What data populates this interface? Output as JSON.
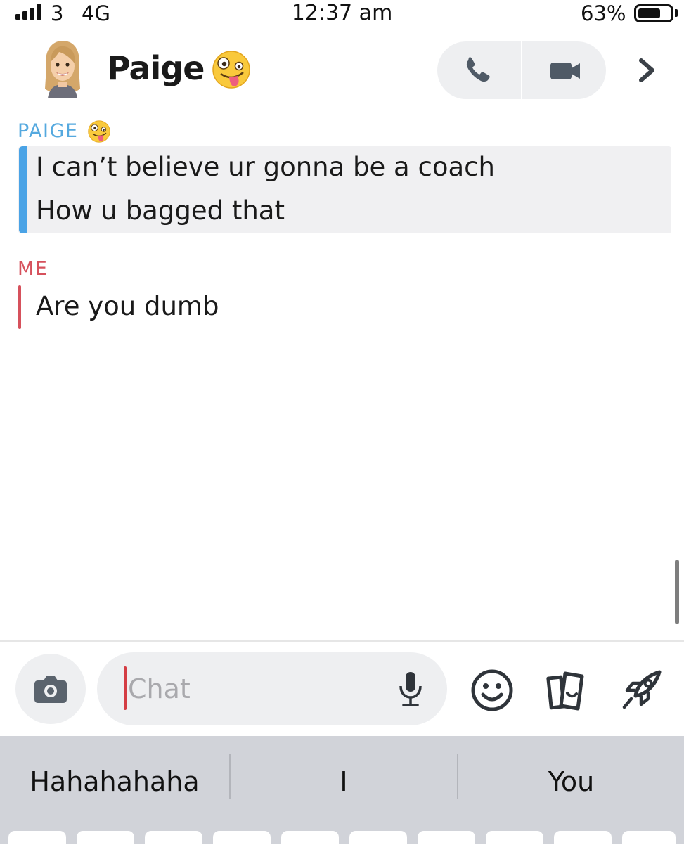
{
  "status_bar": {
    "carrier": "3",
    "network": "4G",
    "time": "12:37 am",
    "battery_percent": "63%",
    "battery_level": 0.63
  },
  "header": {
    "contact_name": "Paige",
    "name_emoji": "zany-face-emoji",
    "avatar": "bitmoji-avatar",
    "call_icon": "phone-icon",
    "video_icon": "video-camera-icon",
    "more_icon": "chevron-right-icon"
  },
  "messages": [
    {
      "sender": "PAIGE",
      "sender_emoji": "zany-face-emoji",
      "color": "#4aa3e6",
      "lines": [
        "I can’t believe ur gonna be a coach",
        "How u bagged that"
      ]
    },
    {
      "sender": "ME",
      "color": "#d6515c",
      "lines": [
        "Are you dumb"
      ]
    }
  ],
  "composer": {
    "placeholder": "Chat",
    "camera_icon": "camera-icon",
    "mic_icon": "microphone-icon",
    "smile_icon": "smiley-icon",
    "sticker_icon": "sticker-cards-icon",
    "rocket_icon": "rocket-icon"
  },
  "keyboard": {
    "suggestions": [
      "Hahahahaha",
      "I",
      "You"
    ]
  },
  "colors": {
    "paige_accent": "#4aa3e6",
    "me_accent": "#d6515c",
    "cursor": "#d43d44"
  }
}
